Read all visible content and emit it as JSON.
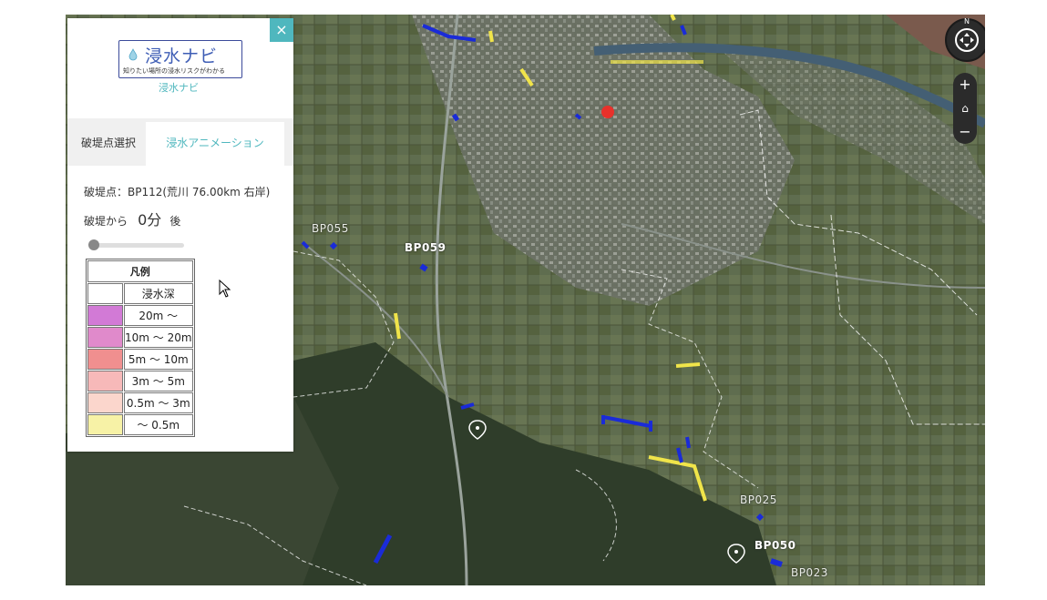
{
  "app": {
    "logo_title": "浸水ナビ",
    "logo_subtitle": "知りたい場所の浸水リスクがわかる",
    "caption": "浸水ナビ",
    "close_label": "×"
  },
  "tabs": [
    {
      "label": "破堤点選択",
      "active": false
    },
    {
      "label": "浸水アニメーション",
      "active": true
    }
  ],
  "info": {
    "breach_point": "破堤点：BP112(荒川 76.00km 右岸)",
    "time_prefix": "破堤から",
    "time_value": "0分",
    "time_suffix": "後",
    "slider_value": 0
  },
  "legend": {
    "title": "凡例",
    "header": "浸水深",
    "rows": [
      {
        "label": "20m ～",
        "color": "#d27ad6"
      },
      {
        "label": "10m ～ 20m",
        "color": "#e08acb"
      },
      {
        "label": "5m ～ 10m",
        "color": "#f08f8f"
      },
      {
        "label": "3m ～ 5m",
        "color": "#f7b9b9"
      },
      {
        "label": "0.5m ～ 3m",
        "color": "#fbd6cc"
      },
      {
        "label": "～ 0.5m",
        "color": "#f7f2a6"
      }
    ]
  },
  "map_labels": {
    "bp055": "BP055",
    "bp059": "BP059",
    "bp025": "BP025",
    "bp050": "BP050",
    "bp023": "BP023"
  },
  "controls": {
    "compass_n": "N",
    "zoom_in": "+",
    "home": "⌂",
    "zoom_out": "−"
  },
  "colors": {
    "accent": "#4fb7be",
    "breach_marker": "#e8312b",
    "blue_segment": "#1a2bd8",
    "yellow_segment": "#f0e44a"
  }
}
